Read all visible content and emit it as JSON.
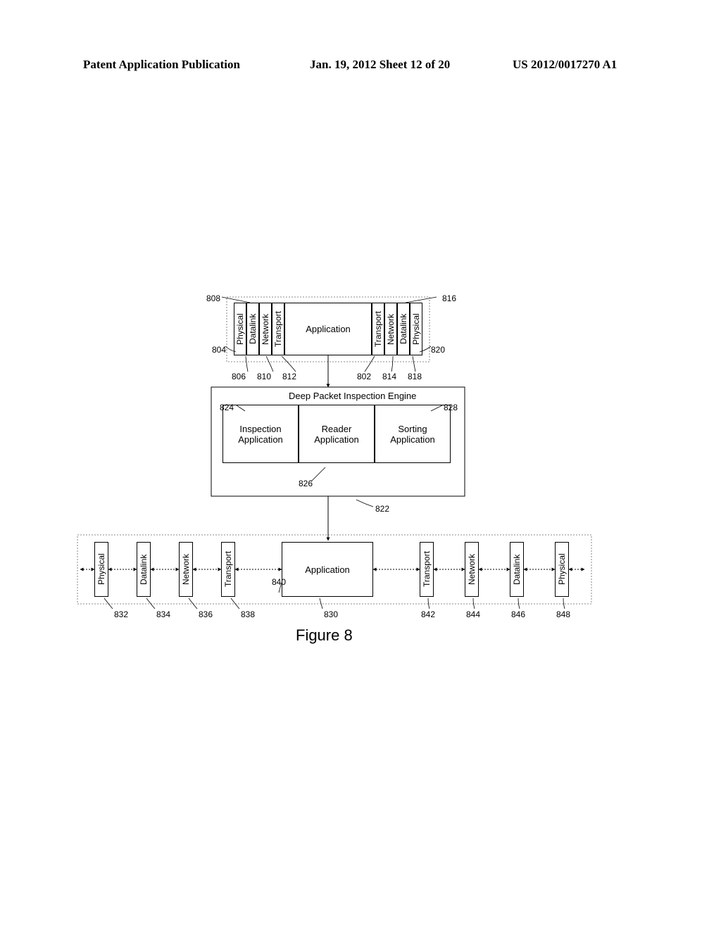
{
  "header": {
    "left": "Patent Application Publication",
    "center": "Jan. 19, 2012  Sheet 12 of 20",
    "right": "US 2012/0017270 A1"
  },
  "topStack": {
    "left": {
      "physical": "Physical",
      "datalink": "Datalink",
      "network": "Network",
      "transport": "Transport"
    },
    "application": "Application",
    "right": {
      "transport": "Transport",
      "network": "Network",
      "datalink": "Datalink",
      "physical": "Physical"
    }
  },
  "dpi": {
    "title": "Deep Packet Inspection Engine",
    "inspection": "Inspection\nApplication",
    "reader": "Reader\nApplication",
    "sorting": "Sorting\nApplication"
  },
  "bottomStack": {
    "left": {
      "physical": "Physical",
      "datalink": "Datalink",
      "network": "Network",
      "transport": "Transport"
    },
    "application": "Application",
    "right": {
      "transport": "Transport",
      "network": "Network",
      "datalink": "Datalink",
      "physical": "Physical"
    }
  },
  "refs": {
    "r802": "802",
    "r804": "804",
    "r806": "806",
    "r808": "808",
    "r810": "810",
    "r812": "812",
    "r814": "814",
    "r816": "816",
    "r818": "818",
    "r820": "820",
    "r822": "822",
    "r824": "824",
    "r826": "826",
    "r828": "828",
    "r830": "830",
    "r832": "832",
    "r834": "834",
    "r836": "836",
    "r838": "838",
    "r840": "840",
    "r842": "842",
    "r844": "844",
    "r846": "846",
    "r848": "848"
  },
  "caption": "Figure 8"
}
